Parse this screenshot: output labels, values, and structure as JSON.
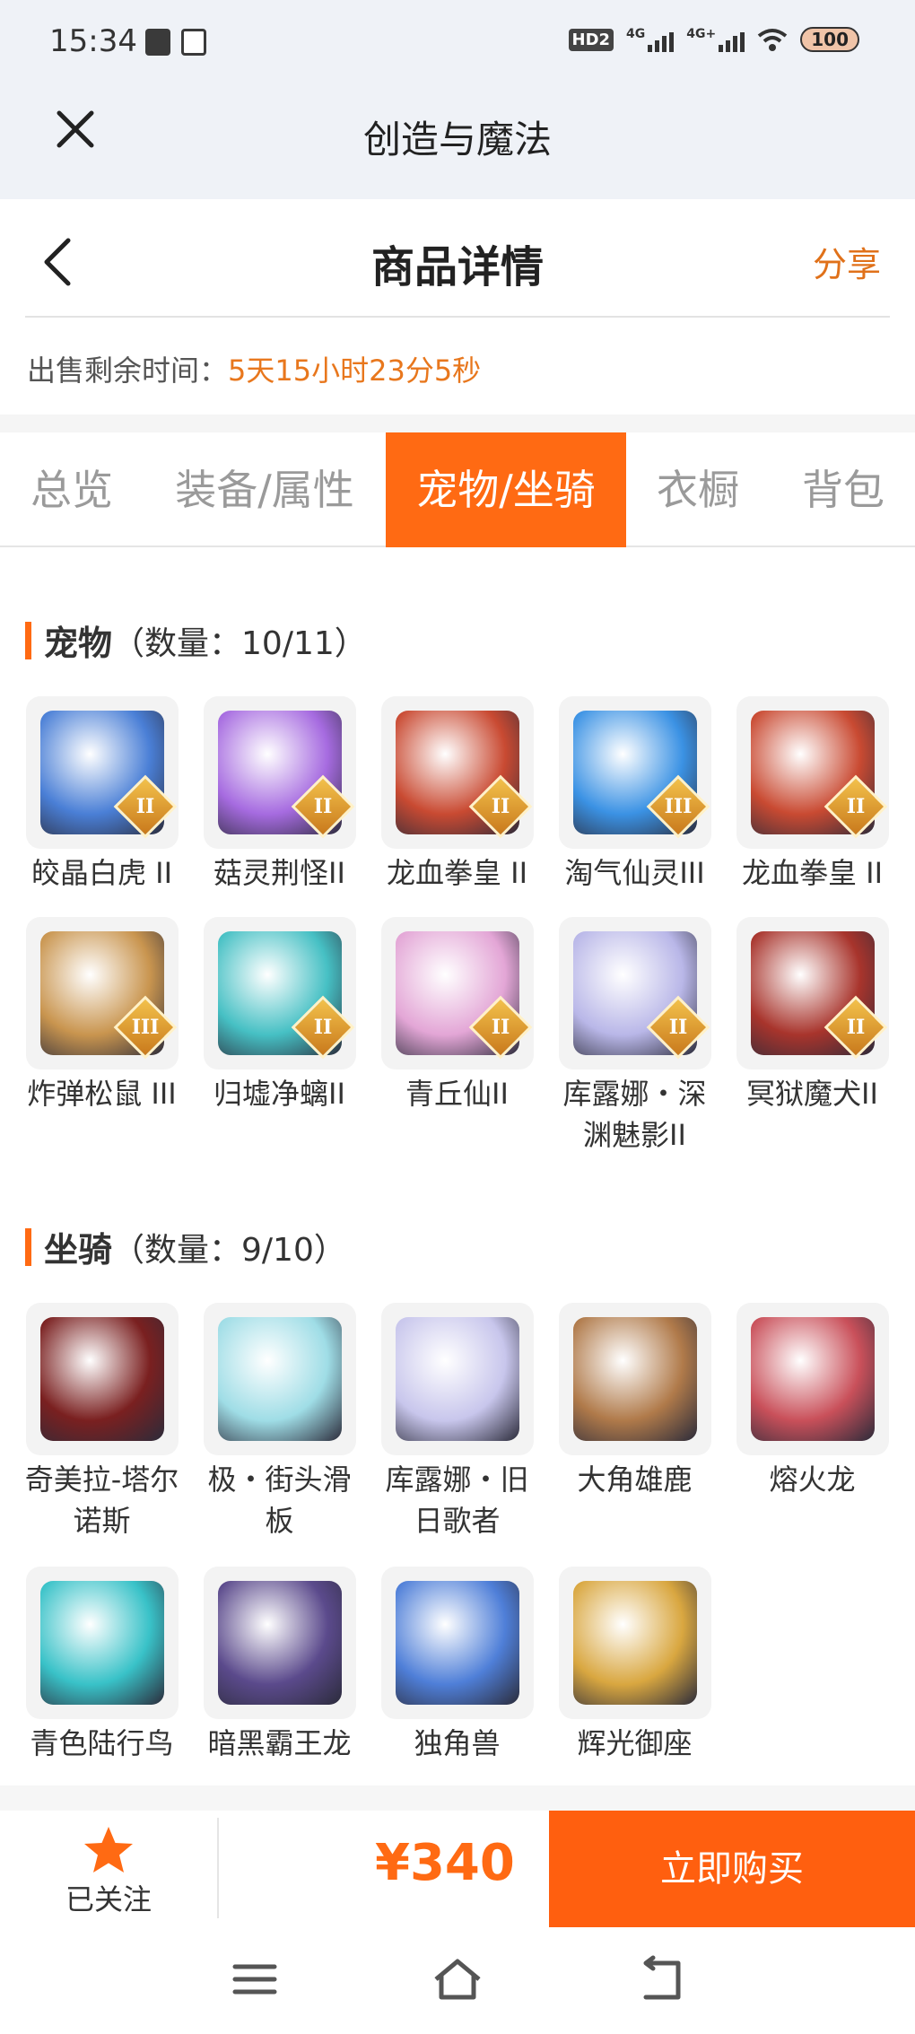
{
  "status_bar": {
    "time": "15:34",
    "hd": "HD2",
    "net1": "4G",
    "net2": "4G+",
    "battery": "100"
  },
  "webview": {
    "title": "创造与魔法",
    "close_icon": "close-icon"
  },
  "header": {
    "title": "商品详情",
    "share": "分享",
    "back_icon": "chevron-left-icon"
  },
  "remaining": {
    "label": "出售剩余时间：",
    "value": "5天15小时23分5秒"
  },
  "tabs": [
    {
      "label": "总览",
      "active": false
    },
    {
      "label": "装备/属性",
      "active": false
    },
    {
      "label": "宠物/坐骑",
      "active": true
    },
    {
      "label": "衣橱",
      "active": false
    },
    {
      "label": "背包",
      "active": false
    }
  ],
  "pets": {
    "title": "宠物",
    "count": "（数量：10/11）",
    "items": [
      {
        "name": "皎晶白虎 II",
        "rank": "II",
        "color": "#4a7fd6"
      },
      {
        "name": "菇灵荆怪II",
        "rank": "II",
        "color": "#a66be0"
      },
      {
        "name": "龙血拳皇 II",
        "rank": "II",
        "color": "#c94a32"
      },
      {
        "name": "淘气仙灵III",
        "rank": "III",
        "color": "#3b92e4"
      },
      {
        "name": "龙血拳皇 II",
        "rank": "II",
        "color": "#c94a32"
      },
      {
        "name": "炸弹松鼠 III",
        "rank": "III",
        "color": "#c9954f"
      },
      {
        "name": "归墟净螭II",
        "rank": "II",
        "color": "#46c0c4"
      },
      {
        "name": "青丘仙II",
        "rank": "II",
        "color": "#e3a6d6"
      },
      {
        "name": "库露娜・深渊魅影II",
        "rank": "II",
        "color": "#b9b7e8"
      },
      {
        "name": "冥狱魔犬II",
        "rank": "II",
        "color": "#a8342c"
      }
    ]
  },
  "mounts": {
    "title": "坐骑",
    "count": "（数量：9/10）",
    "items": [
      {
        "name": "奇美拉-塔尔诺斯",
        "color": "#7a2020"
      },
      {
        "name": "极・街头滑板",
        "color": "#9fdde6"
      },
      {
        "name": "库露娜・旧日歌者",
        "color": "#c8c6ec"
      },
      {
        "name": "大角雄鹿",
        "color": "#b07a4a"
      },
      {
        "name": "熔火龙",
        "color": "#c9505a"
      },
      {
        "name": "青色陆行鸟",
        "color": "#39c2c8"
      },
      {
        "name": "暗黑霸王龙",
        "color": "#5b4a8c"
      },
      {
        "name": "独角兽",
        "color": "#4f7fd8"
      },
      {
        "name": "辉光御座",
        "color": "#d9a740"
      }
    ]
  },
  "bottom": {
    "follow_label": "已关注",
    "price": "¥340",
    "buy_label": "立即购买"
  },
  "colors": {
    "accent": "#ff6a13",
    "time_text": "#e8771d"
  }
}
